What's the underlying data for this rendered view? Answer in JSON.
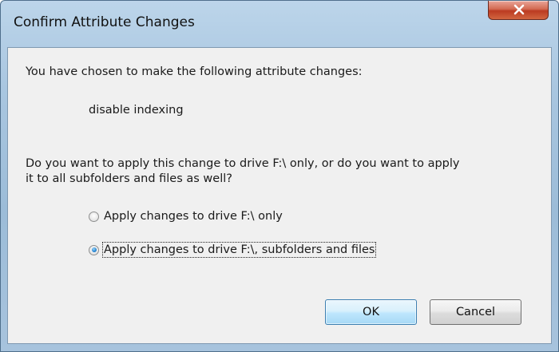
{
  "window": {
    "title": "Confirm Attribute Changes",
    "close_icon": "close-icon"
  },
  "dialog": {
    "intro": "You have chosen to make the following attribute changes:",
    "change": "disable indexing",
    "question_line1": "Do you want to apply this change to drive F:\\ only, or do you want to apply",
    "question_line2": "it to all subfolders and files as well?",
    "options": [
      {
        "label": "Apply changes to drive F:\\ only",
        "checked": false
      },
      {
        "label": "Apply changes to drive F:\\, subfolders and files",
        "checked": true
      }
    ]
  },
  "buttons": {
    "ok": "OK",
    "cancel": "Cancel"
  },
  "colors": {
    "close_button": "#c8452b",
    "radio_selected": "#2a8ad6",
    "default_button_border": "#3c7fb1"
  }
}
